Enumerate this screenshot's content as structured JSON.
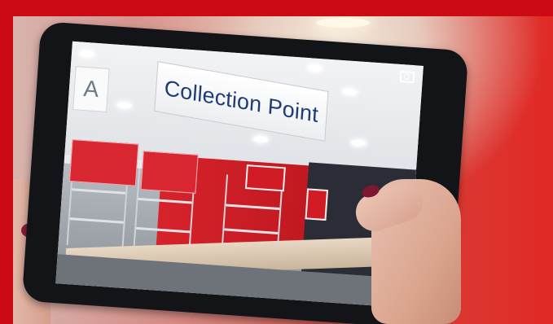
{
  "photo": {
    "description_labels": {
      "sign_text": "Collection Point",
      "aisle_letter": "A"
    },
    "colors": {
      "frame_red": "#cc0a14",
      "sign_text_blue": "#1f3b78",
      "store_red": "#d7232b"
    },
    "icons": [
      "camera-icon"
    ]
  }
}
